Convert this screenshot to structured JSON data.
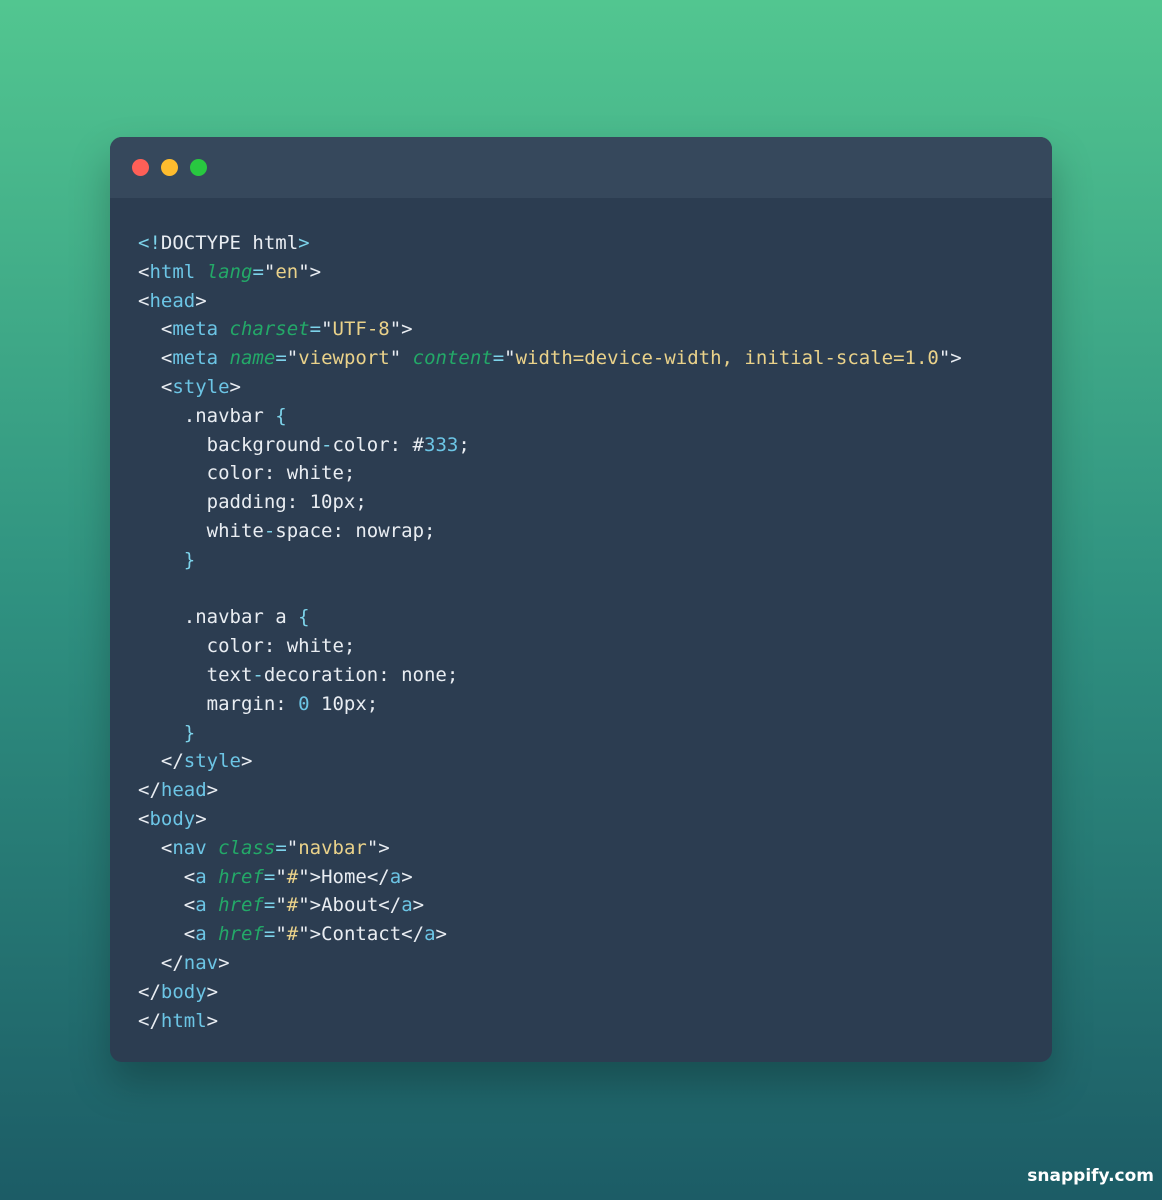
{
  "window": {
    "controls": [
      "close",
      "minimize",
      "maximize"
    ],
    "code_lines": [
      [
        {
          "t": "<!",
          "c": "p"
        },
        {
          "t": "DOCTYPE html",
          "c": "w"
        },
        {
          "t": ">",
          "c": "p"
        }
      ],
      [
        {
          "t": "<",
          "c": "w"
        },
        {
          "t": "html",
          "c": "t"
        },
        {
          "t": " ",
          "c": "w"
        },
        {
          "t": "lang",
          "c": "a"
        },
        {
          "t": "=",
          "c": "p"
        },
        {
          "t": "\"",
          "c": "w"
        },
        {
          "t": "en",
          "c": "s"
        },
        {
          "t": "\">",
          "c": "w"
        }
      ],
      [
        {
          "t": "<",
          "c": "w"
        },
        {
          "t": "head",
          "c": "t"
        },
        {
          "t": ">",
          "c": "w"
        }
      ],
      [
        {
          "t": "  <",
          "c": "w"
        },
        {
          "t": "meta",
          "c": "t"
        },
        {
          "t": " ",
          "c": "w"
        },
        {
          "t": "charset",
          "c": "a"
        },
        {
          "t": "=",
          "c": "p"
        },
        {
          "t": "\"",
          "c": "w"
        },
        {
          "t": "UTF-8",
          "c": "s"
        },
        {
          "t": "\">",
          "c": "w"
        }
      ],
      [
        {
          "t": "  <",
          "c": "w"
        },
        {
          "t": "meta",
          "c": "t"
        },
        {
          "t": " ",
          "c": "w"
        },
        {
          "t": "name",
          "c": "a"
        },
        {
          "t": "=",
          "c": "p"
        },
        {
          "t": "\"",
          "c": "w"
        },
        {
          "t": "viewport",
          "c": "s"
        },
        {
          "t": "\" ",
          "c": "w"
        },
        {
          "t": "content",
          "c": "a"
        },
        {
          "t": "=",
          "c": "p"
        },
        {
          "t": "\"",
          "c": "w"
        },
        {
          "t": "width=device-width, initial-scale=1.0",
          "c": "s"
        },
        {
          "t": "\">",
          "c": "w"
        }
      ],
      [
        {
          "t": "  <",
          "c": "w"
        },
        {
          "t": "style",
          "c": "t"
        },
        {
          "t": ">",
          "c": "w"
        }
      ],
      [
        {
          "t": "    .navbar ",
          "c": "w"
        },
        {
          "t": "{",
          "c": "p"
        }
      ],
      [
        {
          "t": "      background",
          "c": "w"
        },
        {
          "t": "-",
          "c": "p"
        },
        {
          "t": "color: #",
          "c": "w"
        },
        {
          "t": "333",
          "c": "n"
        },
        {
          "t": ";",
          "c": "w"
        }
      ],
      [
        {
          "t": "      color: white;",
          "c": "w"
        }
      ],
      [
        {
          "t": "      padding: 10px;",
          "c": "w"
        }
      ],
      [
        {
          "t": "      white",
          "c": "w"
        },
        {
          "t": "-",
          "c": "p"
        },
        {
          "t": "space: nowrap;",
          "c": "w"
        }
      ],
      [
        {
          "t": "    }",
          "c": "p"
        }
      ],
      [
        {
          "t": "",
          "c": "w"
        }
      ],
      [
        {
          "t": "    .navbar a ",
          "c": "w"
        },
        {
          "t": "{",
          "c": "p"
        }
      ],
      [
        {
          "t": "      color: white;",
          "c": "w"
        }
      ],
      [
        {
          "t": "      text",
          "c": "w"
        },
        {
          "t": "-",
          "c": "p"
        },
        {
          "t": "decoration: none;",
          "c": "w"
        }
      ],
      [
        {
          "t": "      margin: ",
          "c": "w"
        },
        {
          "t": "0",
          "c": "n"
        },
        {
          "t": " 10px;",
          "c": "w"
        }
      ],
      [
        {
          "t": "    }",
          "c": "p"
        }
      ],
      [
        {
          "t": "  </",
          "c": "w"
        },
        {
          "t": "style",
          "c": "t"
        },
        {
          "t": ">",
          "c": "w"
        }
      ],
      [
        {
          "t": "</",
          "c": "w"
        },
        {
          "t": "head",
          "c": "t"
        },
        {
          "t": ">",
          "c": "w"
        }
      ],
      [
        {
          "t": "<",
          "c": "w"
        },
        {
          "t": "body",
          "c": "t"
        },
        {
          "t": ">",
          "c": "w"
        }
      ],
      [
        {
          "t": "  <",
          "c": "w"
        },
        {
          "t": "nav",
          "c": "t"
        },
        {
          "t": " ",
          "c": "w"
        },
        {
          "t": "class",
          "c": "a"
        },
        {
          "t": "=",
          "c": "p"
        },
        {
          "t": "\"",
          "c": "w"
        },
        {
          "t": "navbar",
          "c": "s"
        },
        {
          "t": "\">",
          "c": "w"
        }
      ],
      [
        {
          "t": "    <",
          "c": "w"
        },
        {
          "t": "a",
          "c": "t"
        },
        {
          "t": " ",
          "c": "w"
        },
        {
          "t": "href",
          "c": "a"
        },
        {
          "t": "=",
          "c": "p"
        },
        {
          "t": "\"",
          "c": "w"
        },
        {
          "t": "#",
          "c": "s"
        },
        {
          "t": "\">Home</",
          "c": "w"
        },
        {
          "t": "a",
          "c": "t"
        },
        {
          "t": ">",
          "c": "w"
        }
      ],
      [
        {
          "t": "    <",
          "c": "w"
        },
        {
          "t": "a",
          "c": "t"
        },
        {
          "t": " ",
          "c": "w"
        },
        {
          "t": "href",
          "c": "a"
        },
        {
          "t": "=",
          "c": "p"
        },
        {
          "t": "\"",
          "c": "w"
        },
        {
          "t": "#",
          "c": "s"
        },
        {
          "t": "\">About</",
          "c": "w"
        },
        {
          "t": "a",
          "c": "t"
        },
        {
          "t": ">",
          "c": "w"
        }
      ],
      [
        {
          "t": "    <",
          "c": "w"
        },
        {
          "t": "a",
          "c": "t"
        },
        {
          "t": " ",
          "c": "w"
        },
        {
          "t": "href",
          "c": "a"
        },
        {
          "t": "=",
          "c": "p"
        },
        {
          "t": "\"",
          "c": "w"
        },
        {
          "t": "#",
          "c": "s"
        },
        {
          "t": "\">Contact</",
          "c": "w"
        },
        {
          "t": "a",
          "c": "t"
        },
        {
          "t": ">",
          "c": "w"
        }
      ],
      [
        {
          "t": "  </",
          "c": "w"
        },
        {
          "t": "nav",
          "c": "t"
        },
        {
          "t": ">",
          "c": "w"
        }
      ],
      [
        {
          "t": "</",
          "c": "w"
        },
        {
          "t": "body",
          "c": "t"
        },
        {
          "t": ">",
          "c": "w"
        }
      ],
      [
        {
          "t": "</",
          "c": "w"
        },
        {
          "t": "html",
          "c": "t"
        },
        {
          "t": ">",
          "c": "w"
        }
      ]
    ]
  },
  "watermark": "snappify.com",
  "colors": {
    "background_top": "#52c690",
    "background_bottom": "#1c5c66",
    "window_bg": "#2c3d51",
    "titlebar_bg": "#36485c",
    "close": "#fe5f57",
    "minimize": "#febc2e",
    "maximize": "#28c840",
    "text": "#e9edf2",
    "tag": "#6cc5e5",
    "attribute": "#23a968",
    "string": "#ead28a",
    "punctuation": "#7dd3ea"
  }
}
